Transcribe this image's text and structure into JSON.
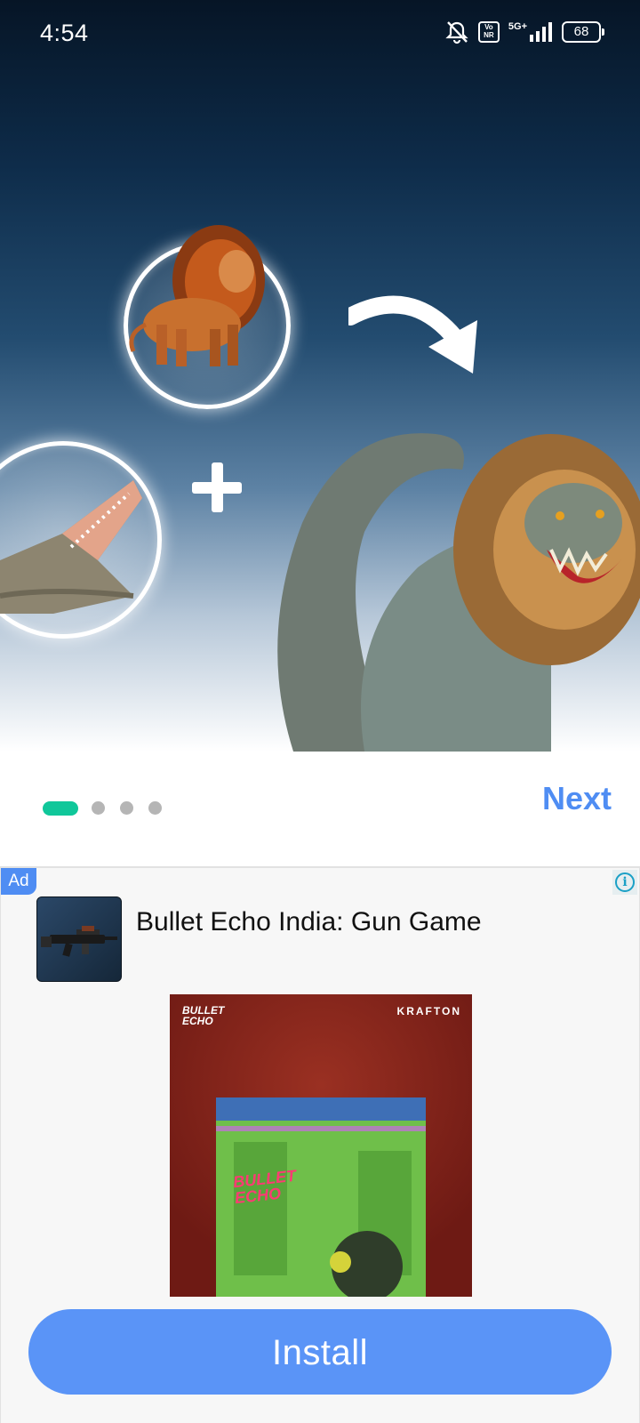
{
  "status_bar": {
    "time": "4:54",
    "network": "5G+",
    "volte": "Vo NR",
    "battery": "68"
  },
  "onboarding": {
    "page_count": 4,
    "current_page": 1,
    "next_label": "Next",
    "accent_color": "#10c79a",
    "link_color": "#4f8df3"
  },
  "ad": {
    "label": "Ad",
    "info_icon": "i",
    "app_name": "Bullet Echo India: Gun Game",
    "creative_brand_left": "BULLET ECHO",
    "creative_brand_right": "KRAFTON",
    "creative_bag_text": "BULLET ECHO",
    "install_label": "Install",
    "button_color": "#5a94f7"
  }
}
